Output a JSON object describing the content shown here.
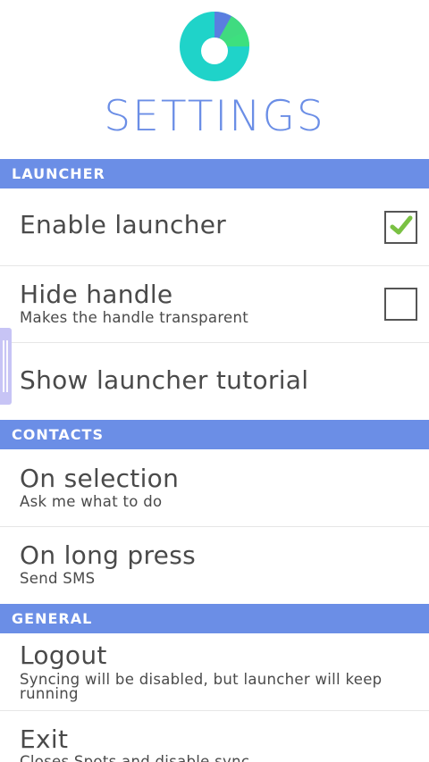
{
  "header": {
    "title": "SETTINGS",
    "logo_icon": "spots-logo-icon"
  },
  "colors": {
    "accent": "#6b8ee6",
    "logo_teal": "#1fd3c9",
    "logo_green": "#3fe07a",
    "logo_blue": "#5a7ee0",
    "check_green": "#7ac143",
    "handle": "#c7c4f5"
  },
  "sections": {
    "launcher": {
      "label": "LAUNCHER",
      "enable_launcher": {
        "title": "Enable launcher",
        "checked": true
      },
      "hide_handle": {
        "title": "Hide handle",
        "subtitle": "Makes the handle transparent",
        "checked": false
      },
      "tutorial": {
        "title": "Show launcher tutorial"
      }
    },
    "contacts": {
      "label": "CONTACTS",
      "on_selection": {
        "title": "On selection",
        "subtitle": "Ask me what to do"
      },
      "on_long_press": {
        "title": "On long press",
        "subtitle": "Send SMS"
      }
    },
    "general": {
      "label": "GENERAL",
      "logout": {
        "title": "Logout",
        "subtitle": "Syncing will be disabled, but launcher will keep running"
      },
      "exit": {
        "title": "Exit",
        "subtitle": "Closes Spots and disable sync"
      }
    }
  }
}
